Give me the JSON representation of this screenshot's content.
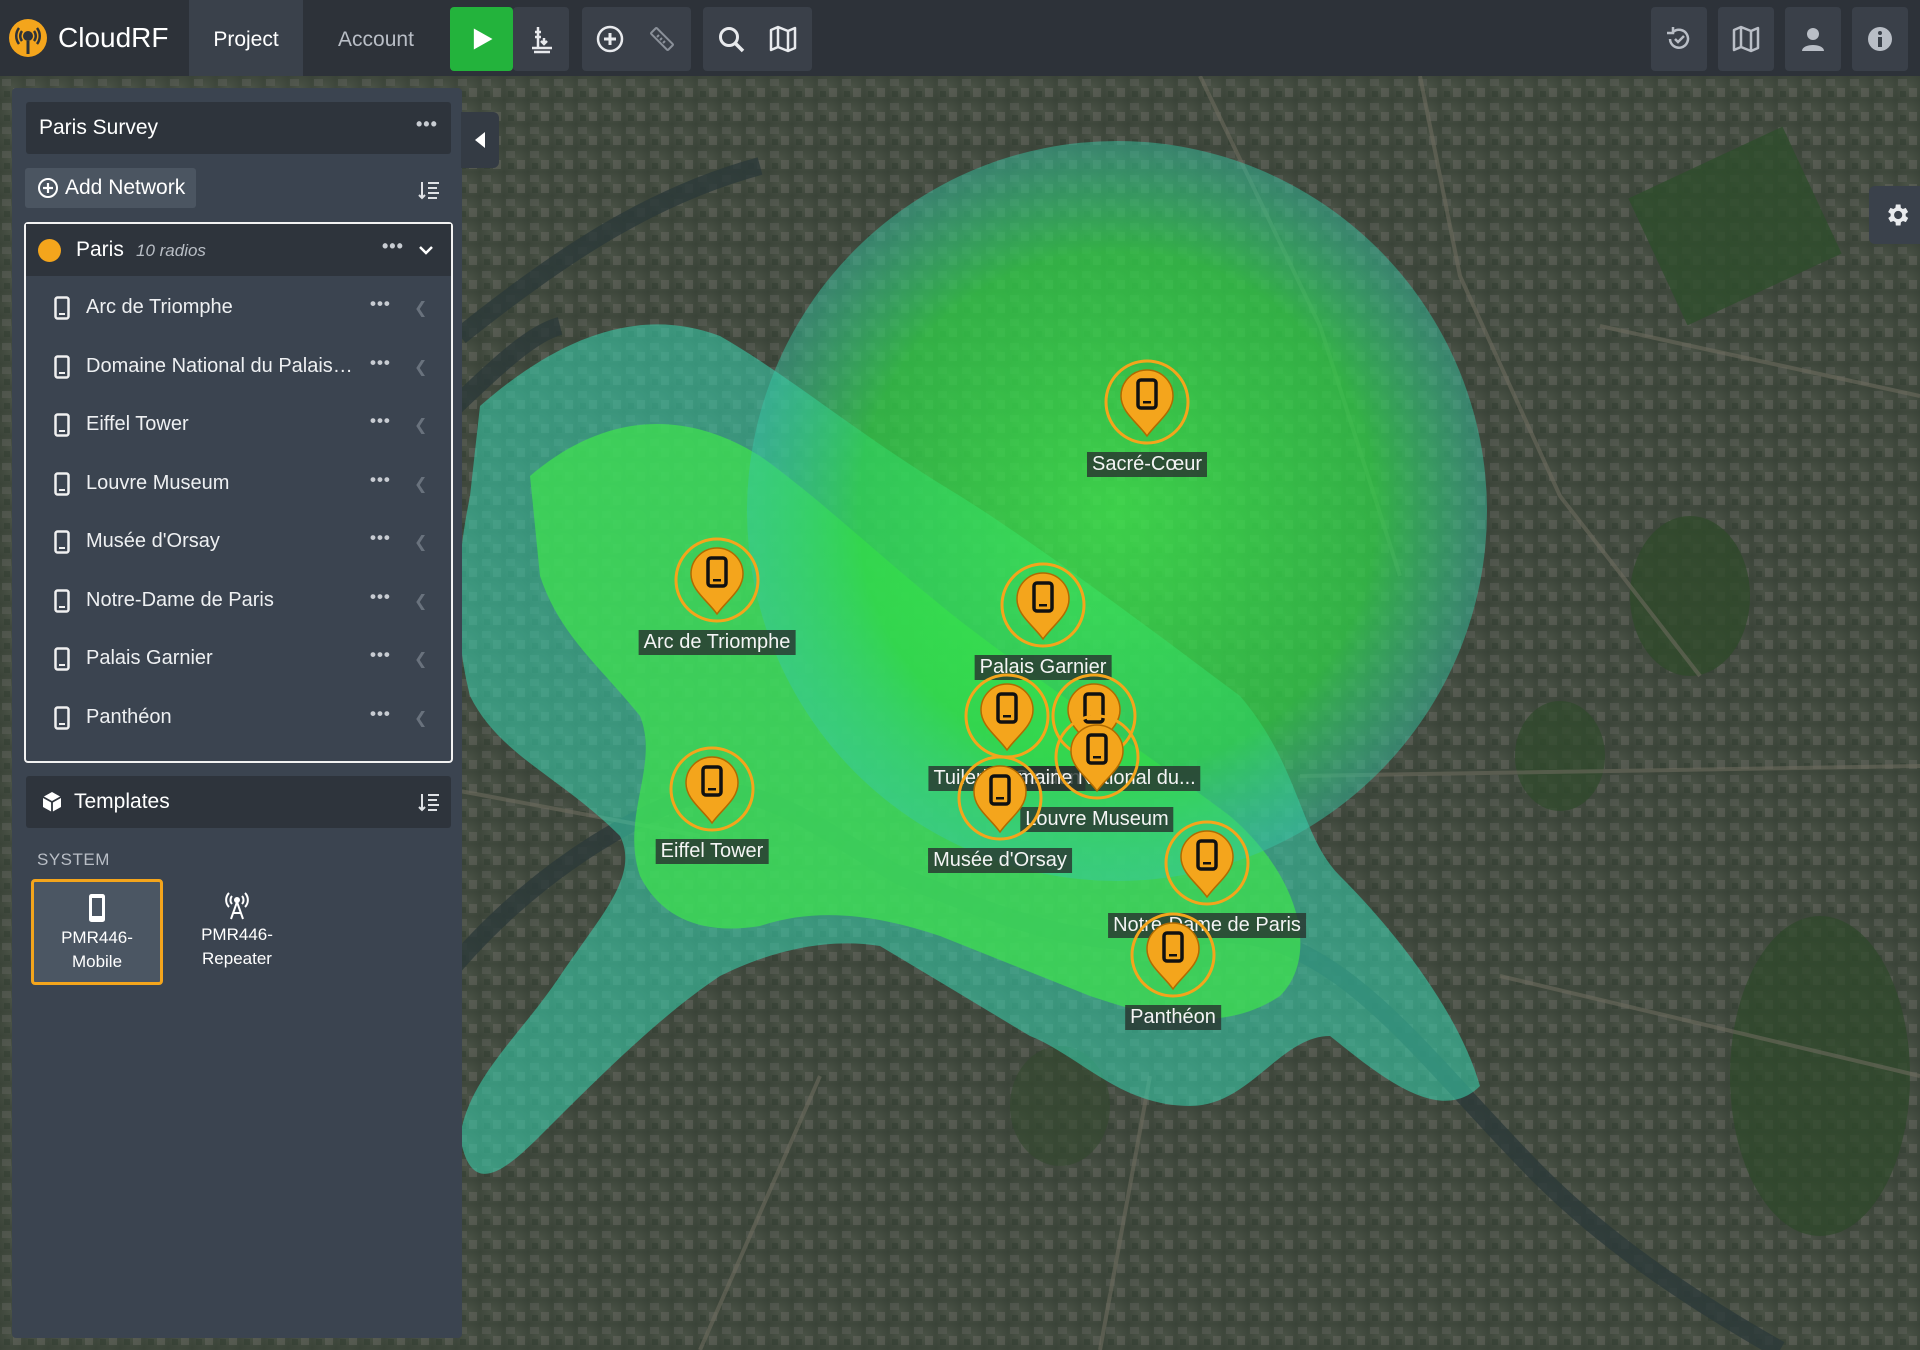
{
  "app": {
    "name": "CloudRF",
    "logo_icon": "cloudrf-logo-icon"
  },
  "nav": {
    "tabs": [
      {
        "label": "Project",
        "active": true
      },
      {
        "label": "Account",
        "active": false
      }
    ]
  },
  "toolbar": {
    "left_tools": [
      "play-icon",
      "antenna-height-icon",
      "add-circle-icon",
      "ruler-icon",
      "search-icon",
      "map-book-icon"
    ],
    "right_tools": [
      "history-icon",
      "docs-book-icon",
      "user-icon",
      "info-icon"
    ],
    "accent_color": "#23b33c"
  },
  "sidebar": {
    "project_title": "Paris Survey",
    "add_network_label": "Add Network",
    "network": {
      "name": "Paris",
      "count_label": "10 radios",
      "color": "#f4a51c",
      "radios": [
        {
          "label": "Arc de Triomphe"
        },
        {
          "label": "Domaine National du Palais…"
        },
        {
          "label": "Eiffel Tower"
        },
        {
          "label": "Louvre Museum"
        },
        {
          "label": "Musée d'Orsay"
        },
        {
          "label": "Notre-Dame de Paris"
        },
        {
          "label": "Palais Garnier"
        },
        {
          "label": "Panthéon"
        }
      ]
    },
    "templates": {
      "title": "Templates",
      "section_label": "SYSTEM",
      "items": [
        {
          "line1": "PMR446-",
          "line2": "Mobile",
          "icon": "mobile-phone-icon",
          "selected": true
        },
        {
          "line1": "PMR446-",
          "line2": "Repeater",
          "icon": "antenna-tower-icon",
          "selected": false
        }
      ]
    }
  },
  "map": {
    "markers": [
      {
        "label": "Sacré-Cœur"
      },
      {
        "label": "Arc de Triomphe"
      },
      {
        "label": "Palais Garnier"
      },
      {
        "label": "Tuileries Garden"
      },
      {
        "label": "Domaine National du..."
      },
      {
        "label": "Louvre Museum"
      },
      {
        "label": "Musée d'Orsay"
      },
      {
        "label": "Eiffel Tower"
      },
      {
        "label": "Notre-Dame de Paris"
      },
      {
        "label": "Panthéon"
      }
    ],
    "marker_color": "#f4a51c",
    "coverage_color": "#2fe34a"
  }
}
